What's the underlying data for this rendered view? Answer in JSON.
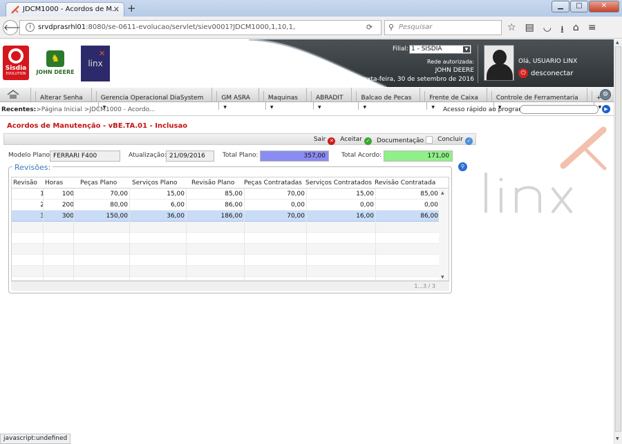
{
  "browser": {
    "tab_title": "JDCM1000 - Acordos de M...",
    "url_host": "srvdprasrhl01",
    "url_path": ":8080/se-0611-evolucao/servlet/siev0001?JDCM1000,1,10,1,",
    "search_placeholder": "Pesquisar",
    "status_text": "javascript:undefined"
  },
  "header": {
    "logo_sisdia": "Sisdia",
    "logo_sisdia_sub": "EVOLUTION",
    "logo_jd": "JOHN DEERE",
    "logo_linx": "linx",
    "filial_label": "Filial:",
    "filial_value": "1 - SISDIA",
    "rede_label": "Rede autorizada:",
    "rede_value": "JOHN DEERE",
    "date": "sexta-feira, 30 de setembro de 2016",
    "greeting": "Olá, USUARIO LINX",
    "logout": "desconectar"
  },
  "menu": {
    "items": [
      "Alterar Senha",
      "Gerencia Operacional DiaSystem",
      "GM ASRA",
      "Maquinas",
      "ABRADIT",
      "Balcao de Pecas",
      "Frente de Caixa",
      "Controle de Ferramentaria",
      "+"
    ]
  },
  "recents": {
    "label": "Recentes:",
    "path": ">Página Inicial >JDCM1000 - Acordo...",
    "quick_label": "Acesso rápido ao programa:"
  },
  "page": {
    "title": "Acordos de Manutenção - vBE.TA.01 - Inclusao"
  },
  "actions": {
    "sair": "Sair",
    "aceitar": "Aceitar",
    "documentacao": "Documentação",
    "concluir": "Concluir"
  },
  "form": {
    "modelo_label": "Modelo Plano:",
    "modelo_value": "FERRARI F400",
    "atualizacao_label": "Atualização:",
    "atualizacao_value": "21/09/2016",
    "total_plano_label": "Total Plano:",
    "total_plano_value": "357,00",
    "total_acordo_label": "Total Acordo:",
    "total_acordo_value": "171,00"
  },
  "revisoes": {
    "legend": "Revisões:",
    "columns": [
      "Revisão",
      "Horas",
      "Peças Plano",
      "Serviços Plano",
      "Revisão Plano",
      "Peças Contratadas",
      "Serviços Contratados",
      "Revisão Contratada"
    ],
    "rows": [
      [
        "1",
        "100",
        "70,00",
        "15,00",
        "85,00",
        "70,00",
        "15,00",
        "85,00"
      ],
      [
        "2",
        "200",
        "80,00",
        "6,00",
        "86,00",
        "0,00",
        "0,00",
        "0,00"
      ],
      [
        "3",
        "300",
        "150,00",
        "36,00",
        "186,00",
        "70,00",
        "16,00",
        "86,00"
      ]
    ],
    "pager": "1...3 / 3"
  },
  "colors": {
    "title_red": "#c31414",
    "total_plano_bg": "#8a8cf2",
    "total_acordo_bg": "#8ff08a",
    "selected_row": "#c9dcf7"
  }
}
